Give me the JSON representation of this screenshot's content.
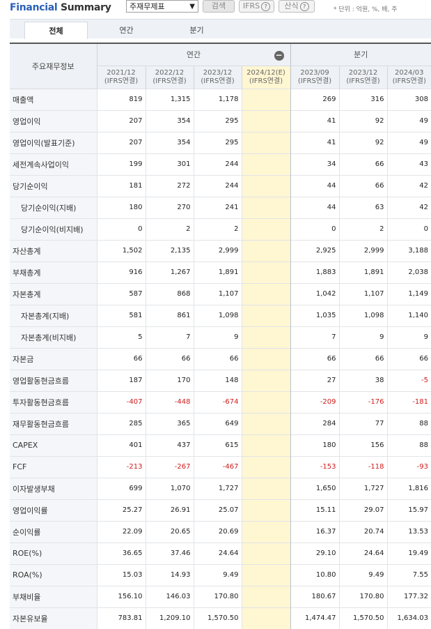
{
  "header": {
    "title_part1": "Financial",
    "title_part2": "Summary",
    "select_value": "주재무제표",
    "search_label": "검색",
    "ifrs_label": "IFRS",
    "calc_label": "산식",
    "help_glyph": "?",
    "unit_text": "* 단위 : 억원, %, 배, 주"
  },
  "tabs": [
    {
      "label": "전체",
      "active": true
    },
    {
      "label": "연간",
      "active": false
    },
    {
      "label": "분기",
      "active": false
    }
  ],
  "table": {
    "row_header": "주요재무정보",
    "group_annual": "연간",
    "group_quarter": "분기",
    "columns": [
      {
        "period": "2021/12",
        "basis": "(IFRS연결)"
      },
      {
        "period": "2022/12",
        "basis": "(IFRS연결)"
      },
      {
        "period": "2023/12",
        "basis": "(IFRS연결)"
      },
      {
        "period": "2024/12(E)",
        "basis": "(IFRS연결)"
      },
      {
        "period": "2023/09",
        "basis": "(IFRS연결)"
      },
      {
        "period": "2023/12",
        "basis": "(IFRS연결)"
      },
      {
        "period": "2024/03",
        "basis": "(IFRS연결)"
      }
    ],
    "rows": [
      {
        "label": "매출액",
        "sub": false,
        "values": [
          "819",
          "1,315",
          "1,178",
          "",
          "269",
          "316",
          "308"
        ]
      },
      {
        "label": "영업이익",
        "sub": false,
        "values": [
          "207",
          "354",
          "295",
          "",
          "41",
          "92",
          "49"
        ]
      },
      {
        "label": "영업이익(발표기준)",
        "sub": false,
        "values": [
          "207",
          "354",
          "295",
          "",
          "41",
          "92",
          "49"
        ]
      },
      {
        "label": "세전계속사업이익",
        "sub": false,
        "values": [
          "199",
          "301",
          "244",
          "",
          "34",
          "66",
          "43"
        ]
      },
      {
        "label": "당기순이익",
        "sub": false,
        "values": [
          "181",
          "272",
          "244",
          "",
          "44",
          "66",
          "42"
        ]
      },
      {
        "label": "당기순이익(지배)",
        "sub": true,
        "values": [
          "180",
          "270",
          "241",
          "",
          "44",
          "63",
          "42"
        ]
      },
      {
        "label": "당기순이익(비지배)",
        "sub": true,
        "values": [
          "0",
          "2",
          "2",
          "",
          "0",
          "2",
          "0"
        ]
      },
      {
        "label": "자산총계",
        "sub": false,
        "values": [
          "1,502",
          "2,135",
          "2,999",
          "",
          "2,925",
          "2,999",
          "3,188"
        ]
      },
      {
        "label": "부채총계",
        "sub": false,
        "values": [
          "916",
          "1,267",
          "1,891",
          "",
          "1,883",
          "1,891",
          "2,038"
        ]
      },
      {
        "label": "자본총계",
        "sub": false,
        "values": [
          "587",
          "868",
          "1,107",
          "",
          "1,042",
          "1,107",
          "1,149"
        ]
      },
      {
        "label": "자본총계(지배)",
        "sub": true,
        "values": [
          "581",
          "861",
          "1,098",
          "",
          "1,035",
          "1,098",
          "1,140"
        ]
      },
      {
        "label": "자본총계(비지배)",
        "sub": true,
        "values": [
          "5",
          "7",
          "9",
          "",
          "7",
          "9",
          "9"
        ]
      },
      {
        "label": "자본금",
        "sub": false,
        "values": [
          "66",
          "66",
          "66",
          "",
          "66",
          "66",
          "66"
        ]
      },
      {
        "label": "영업활동현금흐름",
        "sub": false,
        "values": [
          "187",
          "170",
          "148",
          "",
          "27",
          "38",
          "-5"
        ]
      },
      {
        "label": "투자활동현금흐름",
        "sub": false,
        "values": [
          "-407",
          "-448",
          "-674",
          "",
          "-209",
          "-176",
          "-181"
        ]
      },
      {
        "label": "재무활동현금흐름",
        "sub": false,
        "values": [
          "285",
          "365",
          "649",
          "",
          "284",
          "77",
          "88"
        ]
      },
      {
        "label": "CAPEX",
        "sub": false,
        "values": [
          "401",
          "437",
          "615",
          "",
          "180",
          "156",
          "88"
        ]
      },
      {
        "label": "FCF",
        "sub": false,
        "values": [
          "-213",
          "-267",
          "-467",
          "",
          "-153",
          "-118",
          "-93"
        ]
      },
      {
        "label": "이자발생부채",
        "sub": false,
        "values": [
          "699",
          "1,070",
          "1,727",
          "",
          "1,650",
          "1,727",
          "1,816"
        ]
      },
      {
        "label": "영업이익률",
        "sub": false,
        "values": [
          "25.27",
          "26.91",
          "25.07",
          "",
          "15.11",
          "29.07",
          "15.97"
        ]
      },
      {
        "label": "순이익률",
        "sub": false,
        "values": [
          "22.09",
          "20.65",
          "20.69",
          "",
          "16.37",
          "20.74",
          "13.53"
        ]
      },
      {
        "label": "ROE(%)",
        "sub": false,
        "values": [
          "36.65",
          "37.46",
          "24.64",
          "",
          "29.10",
          "24.64",
          "19.49"
        ]
      },
      {
        "label": "ROA(%)",
        "sub": false,
        "values": [
          "15.03",
          "14.93",
          "9.49",
          "",
          "10.80",
          "9.49",
          "7.55"
        ]
      },
      {
        "label": "부채비율",
        "sub": false,
        "values": [
          "156.10",
          "146.03",
          "170.80",
          "",
          "180.67",
          "170.80",
          "177.32"
        ]
      },
      {
        "label": "자본유보율",
        "sub": false,
        "values": [
          "783.81",
          "1,209.10",
          "1,570.50",
          "",
          "1,474.47",
          "1,570.50",
          "1,634.03"
        ]
      }
    ]
  }
}
